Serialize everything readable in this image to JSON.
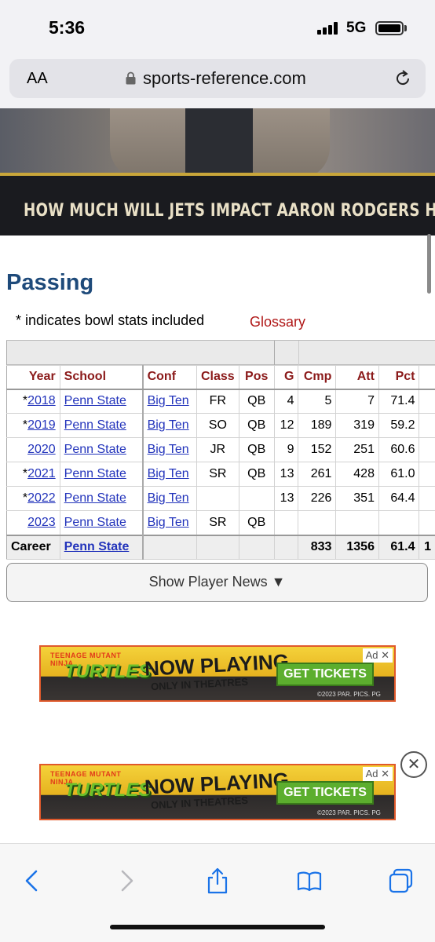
{
  "status_bar": {
    "time": "5:36",
    "network": "5G"
  },
  "browser": {
    "text_size_label": "AA",
    "url": "sports-reference.com"
  },
  "banner": {
    "headline": "HOW MUCH WILL JETS IMPACT AARON RODGERS HOF CAREER?"
  },
  "passing": {
    "title": "Passing",
    "note": "* indicates bowl stats included",
    "glossary_label": "Glossary",
    "columns": [
      "Year",
      "School",
      "Conf",
      "Class",
      "Pos",
      "G",
      "Cmp",
      "Att",
      "Pct"
    ],
    "rows": [
      {
        "year": "*2018",
        "school": "Penn State",
        "conf": "Big Ten",
        "class": "FR",
        "pos": "QB",
        "g": "4",
        "cmp": "5",
        "att": "7",
        "pct": "71.4"
      },
      {
        "year": "*2019",
        "school": "Penn State",
        "conf": "Big Ten",
        "class": "SO",
        "pos": "QB",
        "g": "12",
        "cmp": "189",
        "att": "319",
        "pct": "59.2"
      },
      {
        "year": "2020",
        "school": "Penn State",
        "conf": "Big Ten",
        "class": "JR",
        "pos": "QB",
        "g": "9",
        "cmp": "152",
        "att": "251",
        "pct": "60.6"
      },
      {
        "year": "*2021",
        "school": "Penn State",
        "conf": "Big Ten",
        "class": "SR",
        "pos": "QB",
        "g": "13",
        "cmp": "261",
        "att": "428",
        "pct": "61.0"
      },
      {
        "year": "*2022",
        "school": "Penn State",
        "conf": "Big Ten",
        "class": "",
        "pos": "",
        "g": "13",
        "cmp": "226",
        "att": "351",
        "pct": "64.4"
      },
      {
        "year": "2023",
        "school": "Penn State",
        "conf": "Big Ten",
        "class": "SR",
        "pos": "QB",
        "g": "",
        "cmp": "",
        "att": "",
        "pct": ""
      }
    ],
    "career": {
      "label": "Career",
      "school": "Penn State",
      "cmp": "833",
      "att": "1356",
      "pct": "61.4",
      "next": "1"
    }
  },
  "news_button": {
    "label": "Show Player News ▼"
  },
  "ads": [
    {
      "brand_top": "TEENAGE MUTANT NINJA",
      "brand": "TURTLES",
      "headline": "NOW PLAYING",
      "subline": "ONLY IN THEATRES",
      "cta": "GET TICKETS",
      "fine_print": "©2023 PAR. PICS. PG",
      "ad_label": "Ad ✕"
    },
    {
      "brand_top": "TEENAGE MUTANT NINJA",
      "brand": "TURTLES",
      "headline": "NOW PLAYING",
      "subline": "ONLY IN THEATRES",
      "cta": "GET TICKETS",
      "fine_print": "©2023 PAR. PICS. PG",
      "ad_label": "Ad ✕"
    }
  ],
  "ad_close_glyph": "✕",
  "colors": {
    "section_title": "#1e4a7a",
    "header_text": "#8b1a1a",
    "link": "#2233bb",
    "glossary": "#b01818"
  }
}
